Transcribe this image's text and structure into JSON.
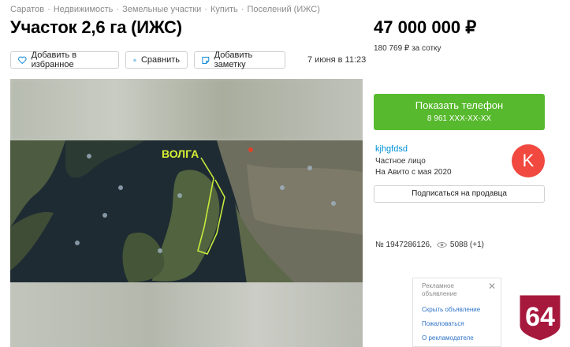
{
  "breadcrumb": [
    "Саратов",
    "Недвижимость",
    "Земельные участки",
    "Купить",
    "Поселений (ИЖС)"
  ],
  "title": "Участок 2,6 га (ИЖС)",
  "actions": {
    "favorite": "Добавить в избранное",
    "compare": "Сравнить",
    "note": "Добавить заметку"
  },
  "date": "7 июня в 11:23",
  "price": "47 000 000 ₽",
  "price_per": "180 769 ₽ за сотку",
  "phone": {
    "label": "Показать телефон",
    "number": "8 961 XXX-XX-XX"
  },
  "seller": {
    "name": "kjhgfdsd",
    "type": "Частное лицо",
    "since": "На Авито с мая 2020",
    "initial": "K"
  },
  "subscribe": "Подписаться на продавца",
  "listing": {
    "id": "№ 1947286126,",
    "views": "5088 (+1)"
  },
  "image": {
    "label": "ВОЛГА"
  },
  "ad": {
    "title": "Рекламное объявление",
    "close": "✕",
    "links": [
      "Скрыть объявление",
      "Пожаловаться",
      "О рекламодателе"
    ]
  },
  "logo": {
    "text": "64"
  },
  "colors": {
    "accent_green": "#57b92d",
    "link_blue": "#0091d9",
    "avatar": "#f1493f",
    "logo": "#a7183d"
  }
}
